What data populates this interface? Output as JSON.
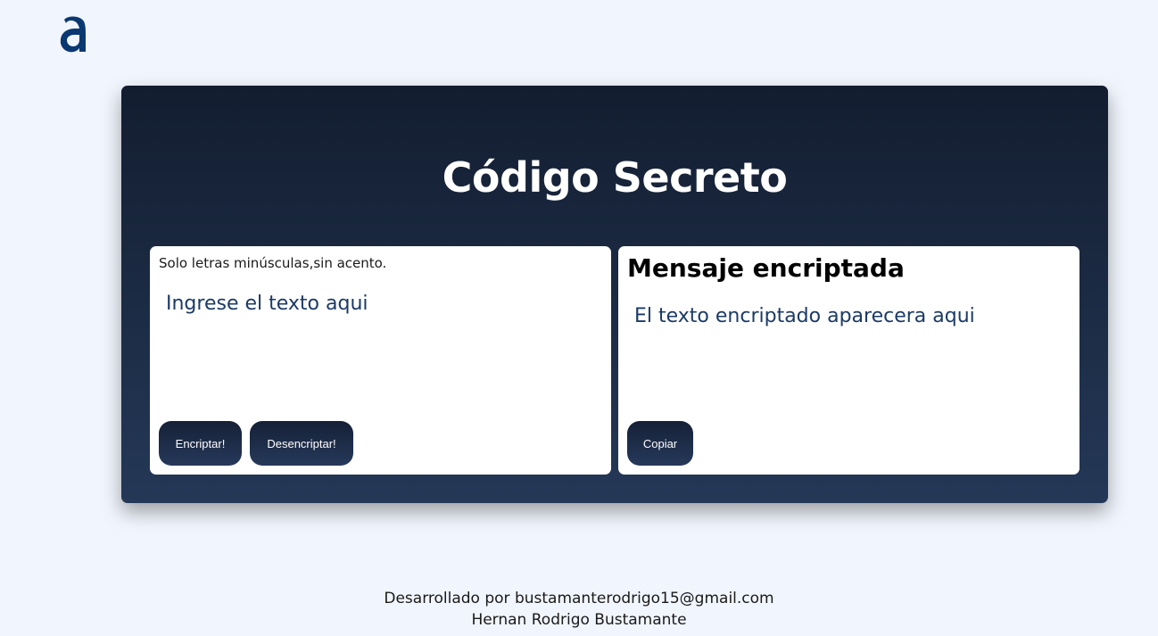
{
  "logo": {
    "icon": "alura-a-logo-icon",
    "color": "#0a3871"
  },
  "main": {
    "title": "Código Secreto",
    "input_panel": {
      "hint": "Solo letras minúsculas,sin acento.",
      "placeholder": "Ingrese el texto aqui",
      "value": "",
      "encrypt_label": "Encriptar!",
      "decrypt_label": "Desencriptar!"
    },
    "output_panel": {
      "heading": "Mensaje encriptada",
      "placeholder_text": "El texto encriptado aparecera aqui",
      "copy_label": "Copiar"
    }
  },
  "footer": {
    "line1": "Desarrollado por bustamanterodrigo15@gmail.com",
    "line2": "Hernan Rodrigo Bustamante"
  },
  "colors": {
    "background": "#f1f5fd",
    "card_top": "#131d30",
    "card_bottom": "#243857",
    "placeholder_text": "#1b3a66"
  }
}
